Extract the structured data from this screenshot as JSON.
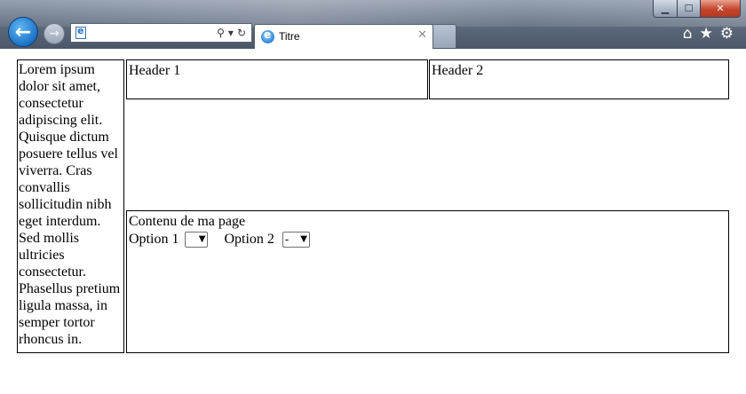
{
  "browser": {
    "window_buttons": {
      "minimize": "▁",
      "maximize": "☐",
      "close": "✕"
    },
    "nav": {
      "back_icon": "←",
      "forward_icon": "→"
    },
    "address": {
      "value": "",
      "tools": [
        "⚲",
        "▾",
        "↻"
      ]
    },
    "tab": {
      "title": "Titre",
      "close": "✕"
    },
    "right_tools": [
      "⌂",
      "★",
      "⚙"
    ],
    "colors": {
      "back_button": "#1d73c7",
      "close_button": "#c4452c"
    }
  },
  "page": {
    "sidebar_text": "Lorem ipsum dolor sit amet, consectetur adipiscing elit. Quisque dictum posuere tellus vel viverra. Cras convallis sollicitudin nibh eget interdum. Sed mollis ultricies consectetur. Phasellus pretium ligula massa, in semper tortor rhoncus in.",
    "header1": "Header 1",
    "header2": "Header 2",
    "content_title": "Contenu de ma page",
    "option1": {
      "label": "Option 1",
      "value": ""
    },
    "option2": {
      "label": "Option 2",
      "value": "-"
    }
  }
}
